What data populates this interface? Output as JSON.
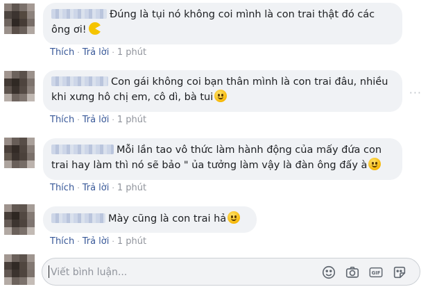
{
  "comments": [
    {
      "text_line1": "Đúng là tụi nó không coi mình là con trai thật đó các",
      "text_line2": "ông ơi!",
      "emoji": "pacman-icon",
      "actions": {
        "like": "Thích",
        "reply": "Trả lời",
        "time": "1 phút"
      }
    },
    {
      "text_line1": "Con gái không coi bạn thân mình là con trai đâu, nhiều",
      "text_line2": "khi xưng hô chị em, cô dì, bà tui",
      "emoji": "smile-icon",
      "more": "···",
      "actions": {
        "like": "Thích",
        "reply": "Trả lời",
        "time": "1 phút"
      }
    },
    {
      "text_line1": "Mỗi lần tao vô thức làm hành động của mấy đứa con",
      "text_line2": "trai hay làm thì nó sẽ bảo \" ủa tưởng làm vậy là đàn ông đấy à",
      "emoji": "smile-icon",
      "actions": {
        "like": "Thích",
        "reply": "Trả lời",
        "time": "1 phút"
      }
    },
    {
      "text_line1": "Mày cũng là con trai hả",
      "emoji": "smile-icon",
      "actions": {
        "like": "Thích",
        "reply": "Trả lời",
        "time": "1 phút"
      }
    }
  ],
  "composer": {
    "placeholder": "Viết bình luận...",
    "icons": [
      "emoji-icon",
      "camera-icon",
      "gif-icon",
      "sticker-icon"
    ]
  },
  "colors": {
    "link": "#385898",
    "bubble": "#f0f2f5",
    "meta": "#90949c"
  }
}
